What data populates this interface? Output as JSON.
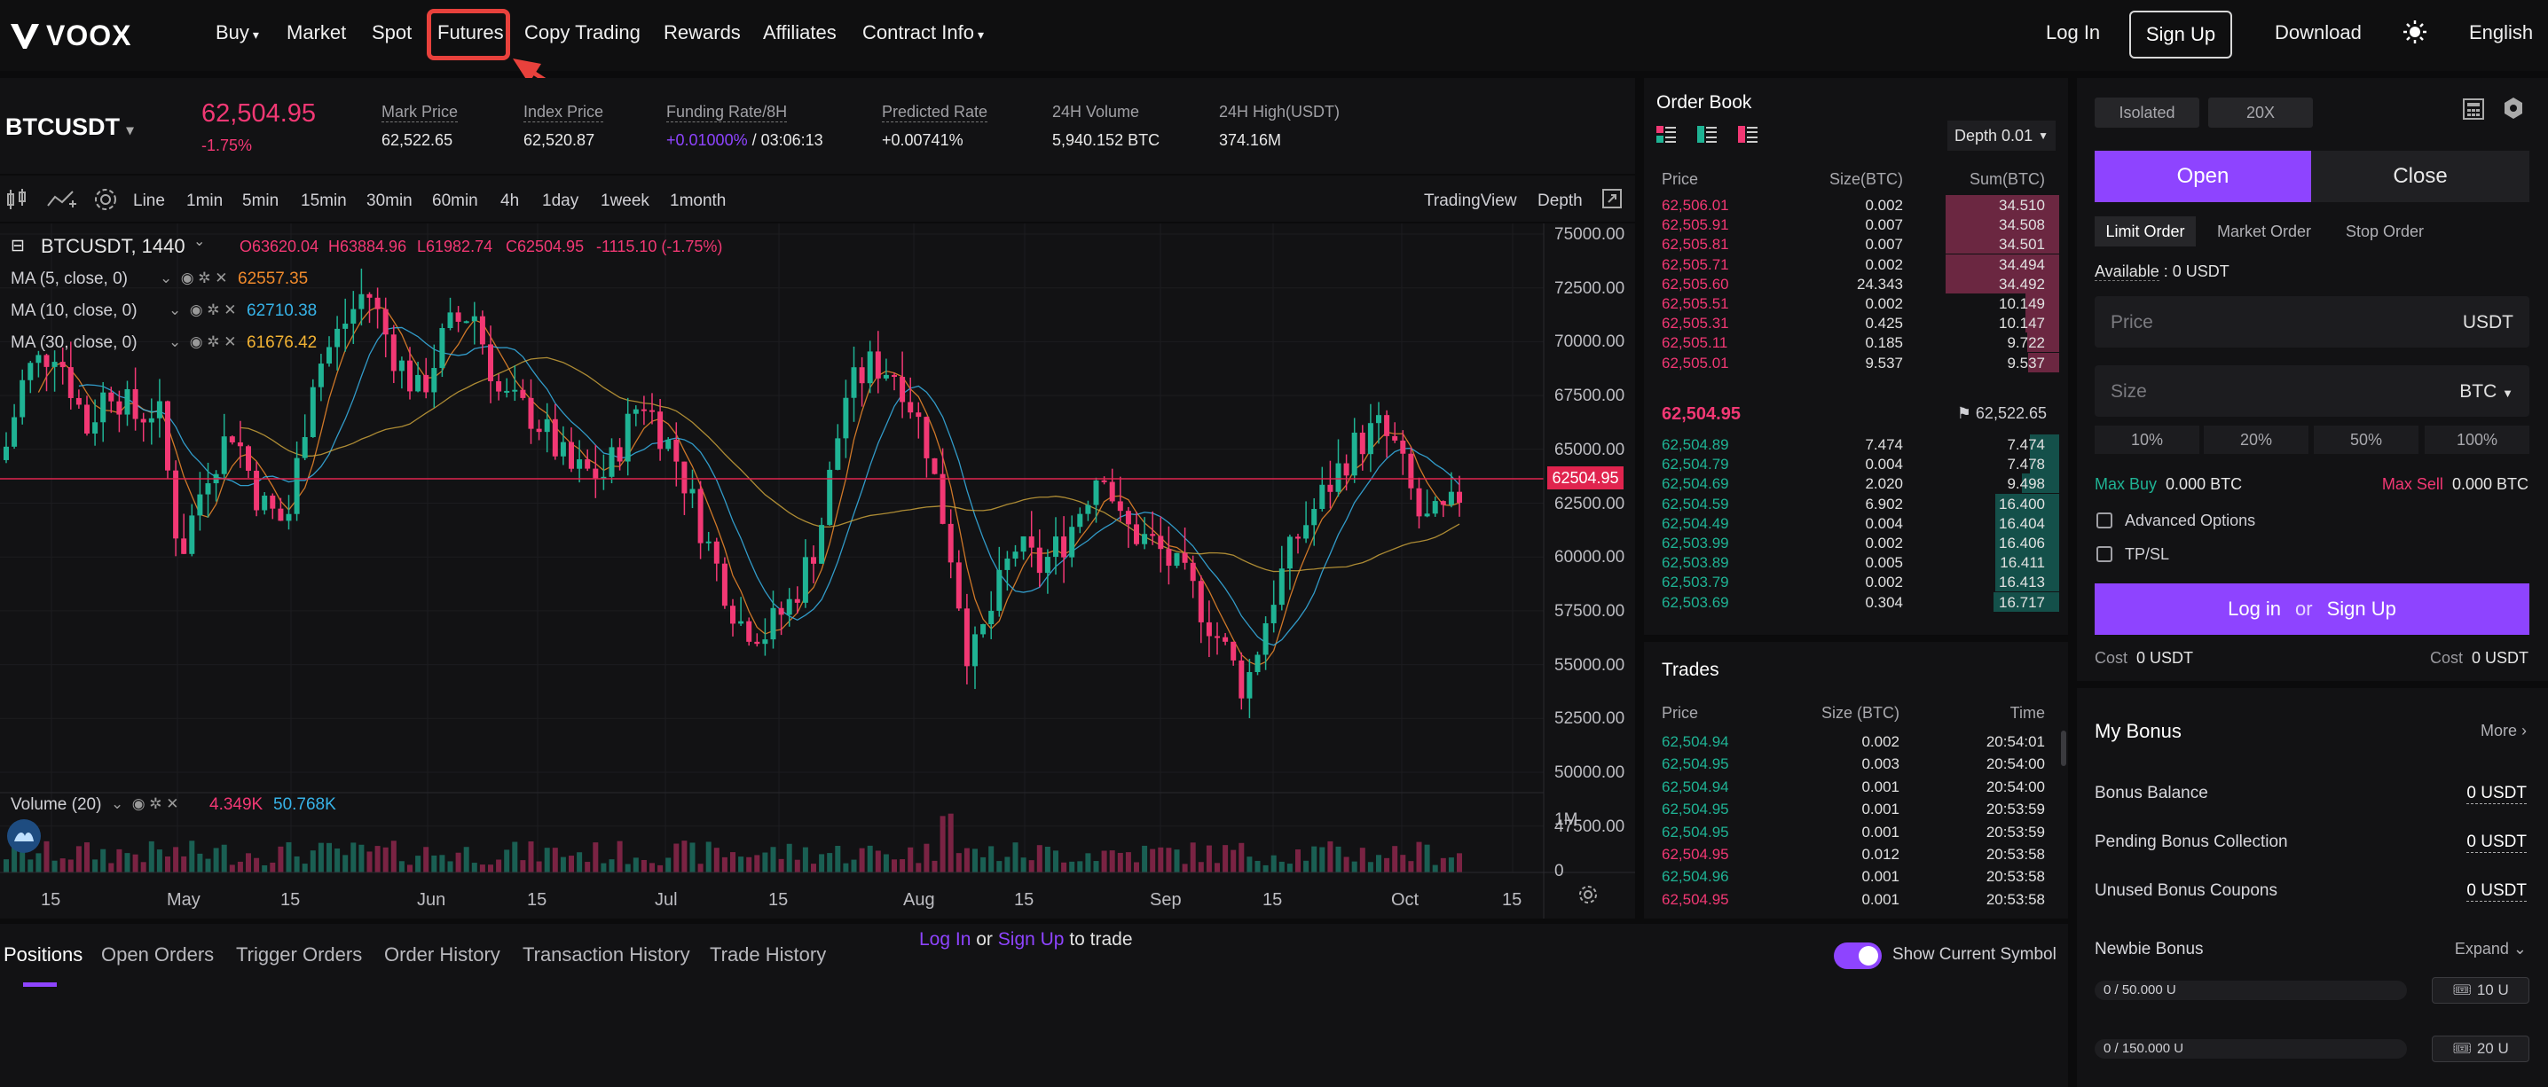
{
  "nav": {
    "logo": "VOOX",
    "items": [
      "Buy",
      "Market",
      "Spot",
      "Futures",
      "Copy Trading",
      "Rewards",
      "Affiliates",
      "Contract Info"
    ],
    "login": "Log In",
    "signup": "Sign Up",
    "download": "Download",
    "language": "English"
  },
  "ticker": {
    "symbol": "BTCUSDT",
    "last_price": "62,504.95",
    "change_pct": "-1.75%",
    "mark_price_label": "Mark Price",
    "mark_price": "62,522.65",
    "index_price_label": "Index Price",
    "index_price": "62,520.87",
    "funding_label": "Funding Rate/8H",
    "funding_rate": "+0.01000%",
    "funding_countdown": "/ 03:06:13",
    "predicted_label": "Predicted Rate",
    "predicted_rate": "+0.00741%",
    "vol_label": "24H Volume",
    "vol": "5,940.152 BTC",
    "high_label": "24H High(USDT)",
    "high": "374.16M"
  },
  "toolbar": {
    "intervals": [
      "Line",
      "1min",
      "5min",
      "15min",
      "30min",
      "60min",
      "4h",
      "1day",
      "1week",
      "1month"
    ],
    "active_interval": "1day",
    "tradingview": "TradingView",
    "depth": "Depth"
  },
  "chart": {
    "legend_symbol": "BTCUSDT, 1440",
    "ohlc_o": "O63620.04",
    "ohlc_h": "H63884.96",
    "ohlc_l": "L61982.74",
    "ohlc_c": "C62504.95",
    "ohlc_chg": "-1115.10 (-1.75%)",
    "ma5_label": "MA (5, close, 0)",
    "ma5_value": "62557.35",
    "ma10_label": "MA (10, close, 0)",
    "ma10_value": "62710.38",
    "ma30_label": "MA (30, close, 0)",
    "ma30_value": "61676.42",
    "volume_label": "Volume (20)",
    "vol_value_1": "4.349K",
    "vol_value_2": "50.768K",
    "price_tag": "62504.95",
    "y_ticks": [
      "75000.00",
      "72500.00",
      "70000.00",
      "67500.00",
      "65000.00",
      "62500.00",
      "60000.00",
      "57500.00",
      "55000.00",
      "52500.00",
      "50000.00",
      "47500.00"
    ],
    "vol_ticks": [
      "1M",
      "0"
    ],
    "x_ticks": [
      "15",
      "May",
      "15",
      "Jun",
      "15",
      "Jul",
      "15",
      "Aug",
      "15",
      "Sep",
      "15",
      "Oct",
      "15"
    ]
  },
  "orderbook": {
    "title": "Order Book",
    "depth": "Depth 0.01",
    "col_price": "Price",
    "col_size": "Size(BTC)",
    "col_sum": "Sum(BTC)",
    "asks": [
      {
        "price": "62,506.01",
        "size": "0.002",
        "sum": "34.510"
      },
      {
        "price": "62,505.91",
        "size": "0.007",
        "sum": "34.508"
      },
      {
        "price": "62,505.81",
        "size": "0.007",
        "sum": "34.501"
      },
      {
        "price": "62,505.71",
        "size": "0.002",
        "sum": "34.494"
      },
      {
        "price": "62,505.60",
        "size": "24.343",
        "sum": "34.492"
      },
      {
        "price": "62,505.51",
        "size": "0.002",
        "sum": "10.149"
      },
      {
        "price": "62,505.31",
        "size": "0.425",
        "sum": "10.147"
      },
      {
        "price": "62,505.11",
        "size": "0.185",
        "sum": "9.722"
      },
      {
        "price": "62,505.01",
        "size": "9.537",
        "sum": "9.537"
      }
    ],
    "mid_price": "62,504.95",
    "mid_mark": "62,522.65",
    "bids": [
      {
        "price": "62,504.89",
        "size": "7.474",
        "sum": "7.474"
      },
      {
        "price": "62,504.79",
        "size": "0.004",
        "sum": "7.478"
      },
      {
        "price": "62,504.69",
        "size": "2.020",
        "sum": "9.498"
      },
      {
        "price": "62,504.59",
        "size": "6.902",
        "sum": "16.400"
      },
      {
        "price": "62,504.49",
        "size": "0.004",
        "sum": "16.404"
      },
      {
        "price": "62,503.99",
        "size": "0.002",
        "sum": "16.406"
      },
      {
        "price": "62,503.89",
        "size": "0.005",
        "sum": "16.411"
      },
      {
        "price": "62,503.79",
        "size": "0.002",
        "sum": "16.413"
      },
      {
        "price": "62,503.69",
        "size": "0.304",
        "sum": "16.717"
      }
    ]
  },
  "trades": {
    "title": "Trades",
    "col_price": "Price",
    "col_size": "Size (BTC)",
    "col_time": "Time",
    "rows": [
      {
        "price": "62,504.94",
        "size": "0.002",
        "time": "20:54:01",
        "side": "buy"
      },
      {
        "price": "62,504.95",
        "size": "0.003",
        "time": "20:54:00",
        "side": "buy"
      },
      {
        "price": "62,504.94",
        "size": "0.001",
        "time": "20:54:00",
        "side": "buy"
      },
      {
        "price": "62,504.95",
        "size": "0.001",
        "time": "20:53:59",
        "side": "buy"
      },
      {
        "price": "62,504.95",
        "size": "0.001",
        "time": "20:53:59",
        "side": "buy"
      },
      {
        "price": "62,504.95",
        "size": "0.012",
        "time": "20:53:58",
        "side": "sell"
      },
      {
        "price": "62,504.96",
        "size": "0.001",
        "time": "20:53:58",
        "side": "buy"
      },
      {
        "price": "62,504.95",
        "size": "0.001",
        "time": "20:53:58",
        "side": "sell"
      }
    ]
  },
  "orderform": {
    "margin_mode": "Isolated",
    "leverage": "20X",
    "open": "Open",
    "close": "Close",
    "types": [
      "Limit Order",
      "Market Order",
      "Stop Order"
    ],
    "available_label": "Available",
    "available_value": ": 0 USDT",
    "price_placeholder": "Price",
    "price_unit": "USDT",
    "size_placeholder": "Size",
    "size_unit": "BTC",
    "pcts": [
      "10%",
      "20%",
      "50%",
      "100%"
    ],
    "max_buy_label": "Max Buy",
    "max_buy": "0.000 BTC",
    "max_sell_label": "Max Sell",
    "max_sell": "0.000 BTC",
    "advanced": "Advanced Options",
    "tpsl": "TP/SL",
    "login": "Log in",
    "or": "or",
    "signup": "Sign Up",
    "cost_label": "Cost",
    "cost_left": "0 USDT",
    "cost_right": "0 USDT"
  },
  "bonus": {
    "title": "My Bonus",
    "more": "More",
    "balance_label": "Bonus Balance",
    "balance": "0 USDT",
    "pending_label": "Pending Bonus Collection",
    "pending": "0 USDT",
    "unused_label": "Unused Bonus Coupons",
    "unused": "0 USDT",
    "newbie_label": "Newbie Bonus",
    "expand": "Expand",
    "progress1": "0 / 50.000 U",
    "reward1": "10 U",
    "progress2": "0 / 150.000 U",
    "reward2": "20 U"
  },
  "bottom": {
    "tabs": [
      "Positions",
      "Open Orders",
      "Trigger Orders",
      "Order History",
      "Transaction History",
      "Trade History"
    ],
    "login": "Log In",
    "or": "or",
    "signup": "Sign Up",
    "to_trade": "to trade",
    "show_current": "Show Current Symbol"
  },
  "colors": {
    "accent": "#8e44ff",
    "up": "#1fb394",
    "down": "#f23874",
    "highlight": "#e8413c"
  }
}
